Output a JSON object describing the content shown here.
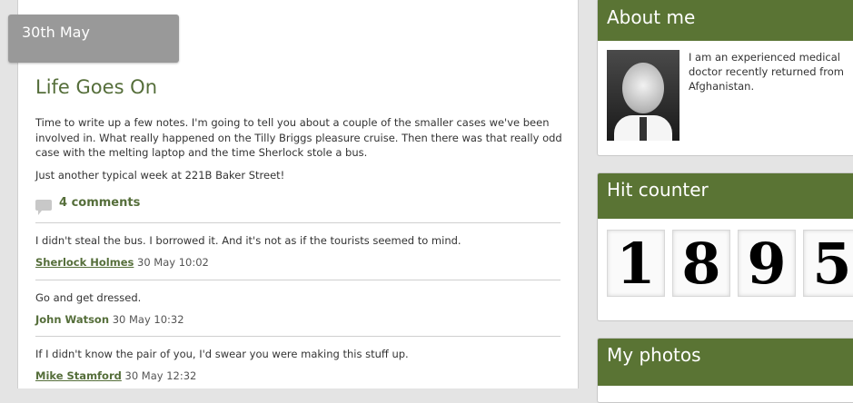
{
  "post": {
    "date": "30th May",
    "title": "Life Goes On",
    "paragraphs": [
      "Time to write up a few notes. I'm going to tell you about a couple of the smaller cases we've been involved in. What really happened on the Tilly Briggs pleasure cruise. Then there was that really odd case with the melting laptop and the time Sherlock stole a bus.",
      "Just another typical week at 221B Baker Street!"
    ],
    "comments_label": "4 comments",
    "comments_icon": "comment-bubble-icon"
  },
  "comments": [
    {
      "text": "I didn't steal the bus. I borrowed it. And it's not as if the tourists seemed to mind.",
      "author": "Sherlock Holmes",
      "timestamp": "30 May 10:02"
    },
    {
      "text": "Go and get dressed.",
      "author": "John Watson",
      "timestamp": "30 May 10:32"
    },
    {
      "text": "If I didn't know the pair of you, I'd swear you were making this stuff up.",
      "author": "Mike Stamford",
      "timestamp": "30 May 12:32"
    }
  ],
  "sidebar": {
    "about": {
      "title": "About me",
      "text": "I am an experienced medical doctor recently returned from Afghanistan."
    },
    "counter": {
      "title": "Hit counter",
      "digits": [
        "1",
        "8",
        "9",
        "5"
      ]
    },
    "photos": {
      "title": "My photos"
    }
  },
  "colors": {
    "accent": "#5a7434",
    "link": "#556e3a",
    "date_tab": "#999999"
  }
}
